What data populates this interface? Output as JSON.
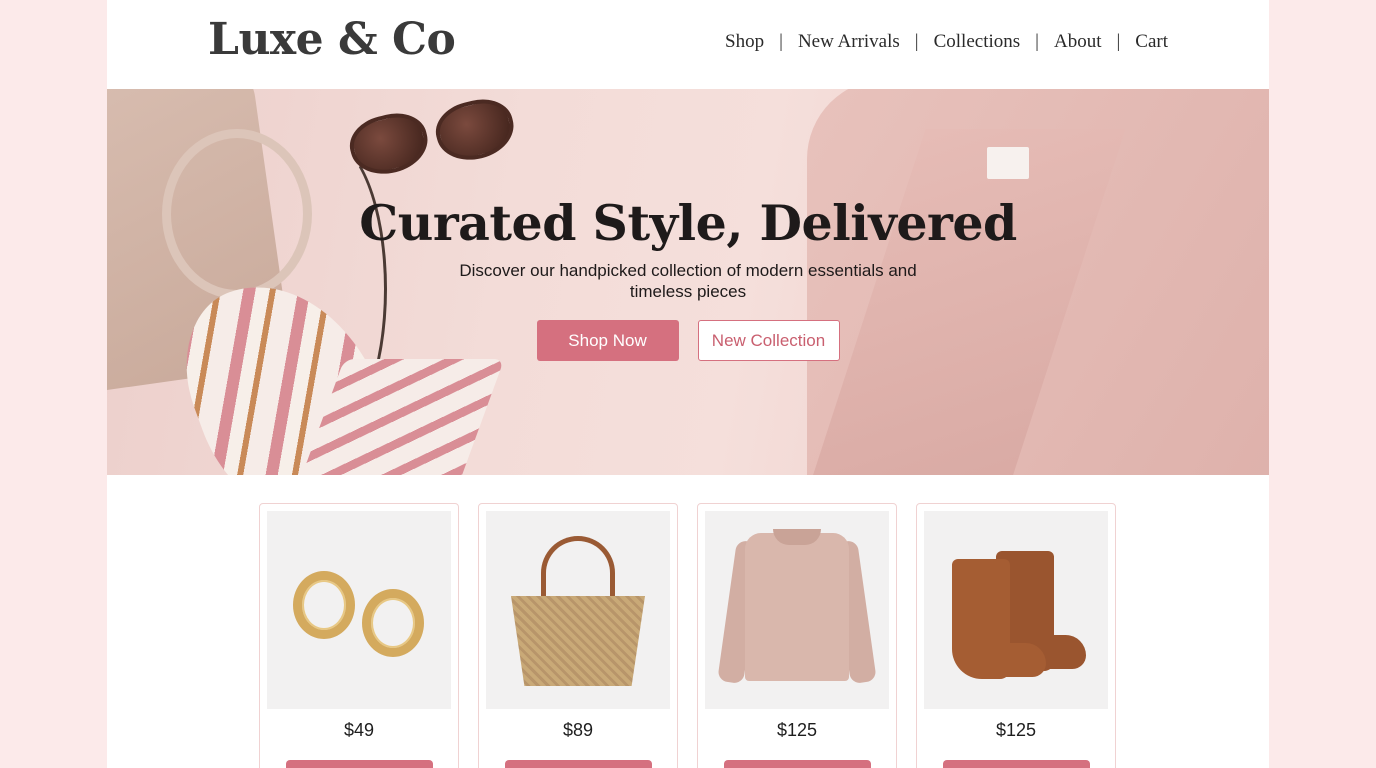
{
  "brand": {
    "logo": "Luxe & Co"
  },
  "nav": {
    "items": [
      "Shop",
      "New Arrivals",
      "Collections",
      "About",
      "Cart"
    ],
    "separator": "|"
  },
  "hero": {
    "title": "Curated Style, Delivered",
    "subtitle": "Discover our handpicked collection of modern essentials and timeless pieces",
    "primary_button": "Shop Now",
    "secondary_button": "New Collection"
  },
  "products": [
    {
      "icon": "gold-hoop-earrings",
      "price": "$49"
    },
    {
      "icon": "woven-tote-bag",
      "price": "$89"
    },
    {
      "icon": "pink-sweater",
      "price": "$125"
    },
    {
      "icon": "brown-chelsea-boots",
      "price": "$125"
    }
  ],
  "colors": {
    "accent": "#d5707f",
    "page_background": "#fceaea",
    "hero_background": "#f3dcd8"
  }
}
